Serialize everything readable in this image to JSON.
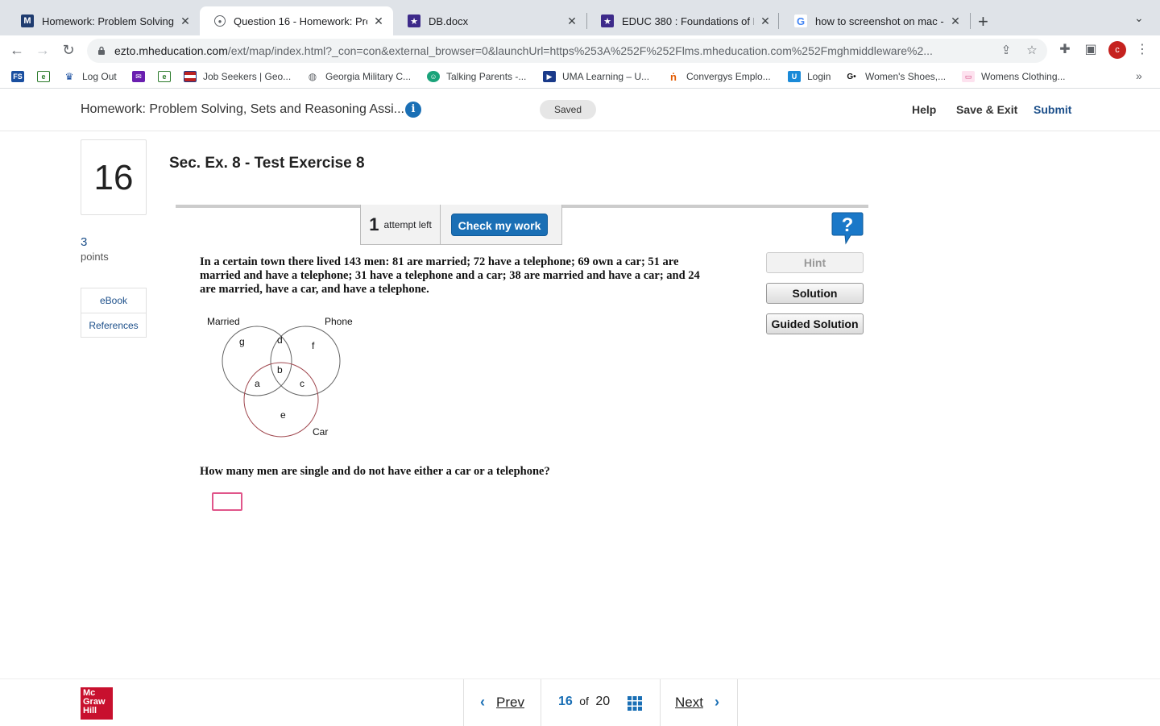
{
  "browser": {
    "tabs": [
      {
        "label": "Homework: Problem Solving, S",
        "active": false
      },
      {
        "label": "Question 16 - Homework: Prob",
        "active": true
      },
      {
        "label": "DB.docx",
        "active": false
      },
      {
        "label": "EDUC 380 : Foundations of Ed",
        "active": false
      },
      {
        "label": "how to screenshot on mac - Go",
        "active": false
      }
    ],
    "url_host": "ezto.mheducation.com",
    "url_path": "/ext/map/index.html?_con=con&external_browser=0&launchUrl=https%253A%252F%252Flms.mheducation.com%252Fmghmiddleware%2...",
    "profile_initial": "c",
    "bookmarks": [
      {
        "label": "",
        "icon": "fs-icon"
      },
      {
        "label": "",
        "icon": "sheet-icon"
      },
      {
        "label": "Log Out",
        "icon": "crown-icon"
      },
      {
        "label": "",
        "icon": "mail-icon"
      },
      {
        "label": "",
        "icon": "sheet-icon"
      },
      {
        "label": "Job Seekers | Geo...",
        "icon": "flag-icon"
      },
      {
        "label": "Georgia Military C...",
        "icon": "globe-icon"
      },
      {
        "label": "Talking Parents -...",
        "icon": "face-icon"
      },
      {
        "label": "UMA Learning – U...",
        "icon": "uma-icon"
      },
      {
        "label": "Convergys Emplo...",
        "icon": "convergys-icon"
      },
      {
        "label": "Login",
        "icon": "u-icon"
      },
      {
        "label": "Women's Shoes,...",
        "icon": "go-icon"
      },
      {
        "label": "Womens Clothing...",
        "icon": "shop-icon"
      }
    ]
  },
  "header": {
    "title": "Homework: Problem Solving, Sets and Reasoning Assi...",
    "saved": "Saved",
    "help": "Help",
    "save_exit": "Save & Exit",
    "submit": "Submit"
  },
  "sidebar": {
    "question_number": "16",
    "points_value": "3",
    "points_label": "points",
    "links": [
      "eBook",
      "References"
    ]
  },
  "question": {
    "section_title": "Sec. Ex. 8 - Test Exercise 8",
    "attempts_num": "1",
    "attempts_label": "attempt left",
    "check_label": "Check my work",
    "problem_text": "In a certain town there lived 143 men: 81 are married; 72 have a telephone; 69 own a car; 51 are married and have a telephone; 31 have a telephone and a car; 38 are married and have a car; and 24 are married, have a car, and have a telephone.",
    "prompt": "How many men are single and do not have either a car or a telephone?",
    "answer_value": "",
    "buttons": {
      "hint": "Hint",
      "solution": "Solution",
      "guided": "Guided Solution"
    },
    "venn": {
      "labels": {
        "married": "Married",
        "phone": "Phone",
        "car": "Car"
      },
      "regions": {
        "g": "g",
        "d": "d",
        "f": "f",
        "a": "a",
        "b": "b",
        "c": "c",
        "e": "e"
      }
    }
  },
  "footer": {
    "logo_lines": [
      "Mc",
      "Graw",
      "Hill"
    ],
    "prev": "Prev",
    "next": "Next",
    "current": "16",
    "of": "of",
    "total": "20"
  },
  "colors": {
    "accent": "#1a6fb5",
    "brand_red": "#c8102e",
    "answer_border": "#e0558a"
  }
}
